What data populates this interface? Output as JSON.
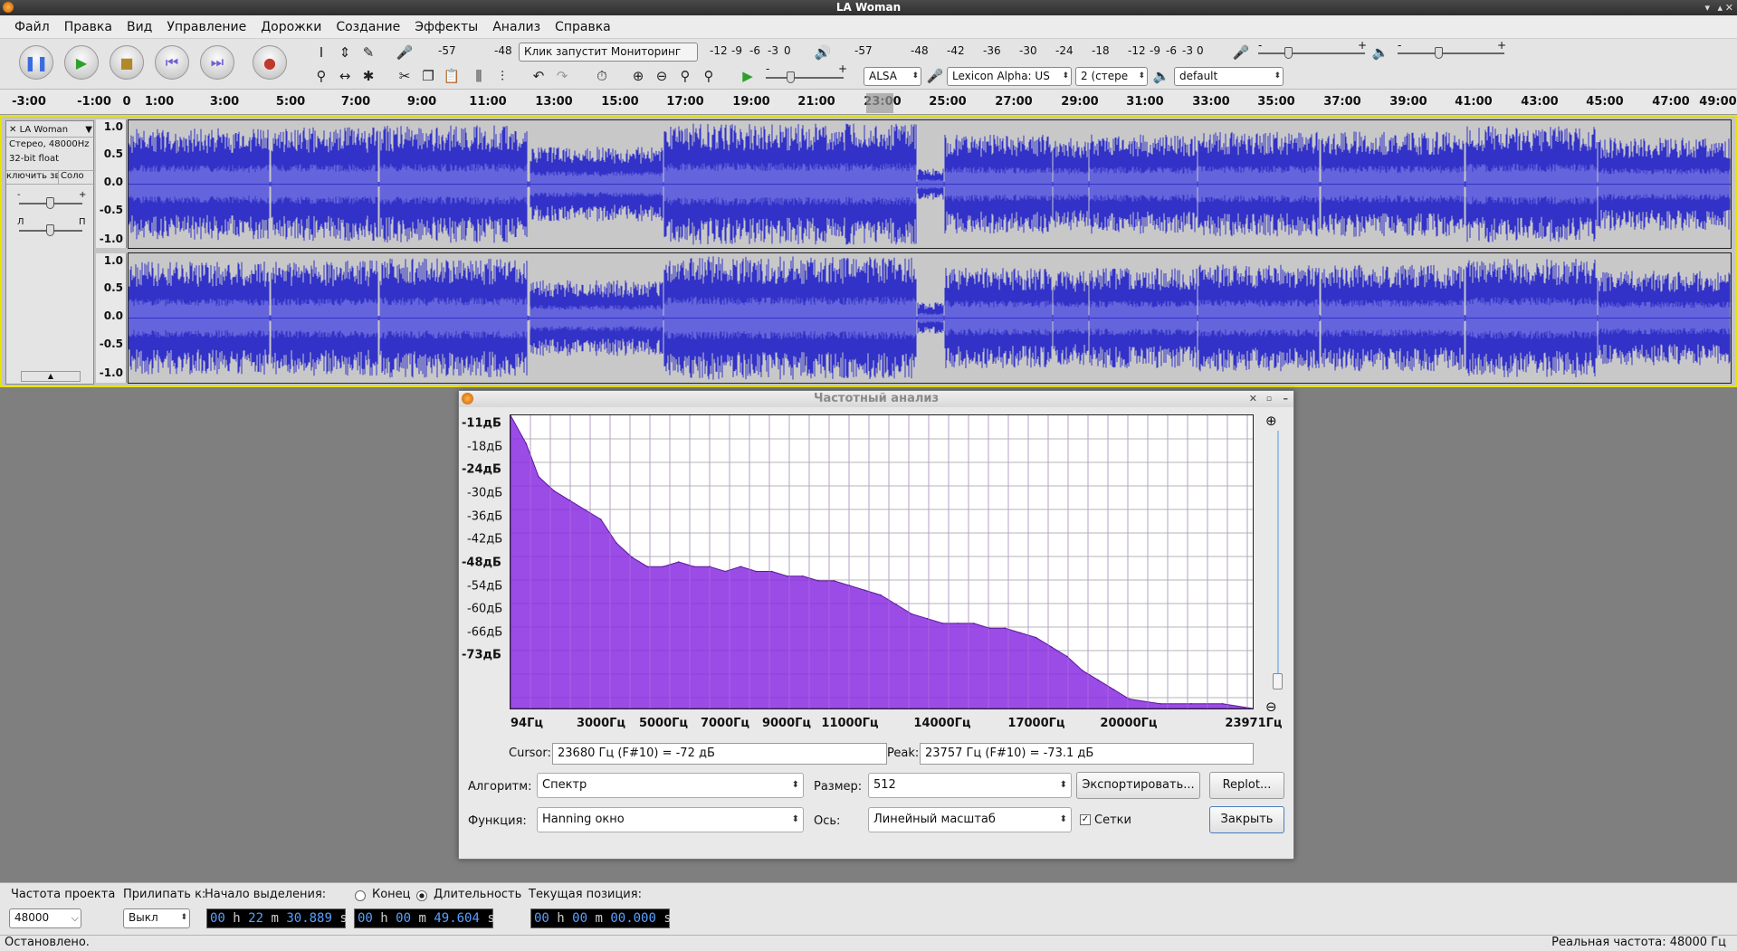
{
  "window": {
    "title": "LA Woman"
  },
  "menu": [
    "Файл",
    "Правка",
    "Вид",
    "Управление",
    "Дорожки",
    "Создание",
    "Эффекты",
    "Анализ",
    "Справка"
  ],
  "toolbar": {
    "rec_meter_ticks": [
      "-57",
      "-48",
      "-12",
      "-9",
      "-6",
      "-3",
      "0"
    ],
    "monitor_text": "Клик запустит Мониторинг",
    "play_meter_ticks": [
      "-57",
      "-48",
      "-42",
      "-36",
      "-30",
      "-24",
      "-18",
      "-12",
      "-9",
      "-6",
      "-3",
      "0"
    ],
    "host": "ALSA",
    "rec_device": "Lexicon Alpha: US",
    "channels": "2 (стере",
    "play_device": "default",
    "slider_minus": "-",
    "slider_plus": "+"
  },
  "ruler": {
    "labels": [
      "-3:00",
      "-1:00",
      "0",
      "1:00",
      "3:00",
      "5:00",
      "7:00",
      "9:00",
      "11:00",
      "13:00",
      "15:00",
      "17:00",
      "19:00",
      "21:00",
      "23:00",
      "25:00",
      "27:00",
      "29:00",
      "31:00",
      "33:00",
      "35:00",
      "37:00",
      "39:00",
      "41:00",
      "43:00",
      "45:00",
      "47:00",
      "49:00"
    ]
  },
  "track": {
    "name": "LA Woman",
    "info1": "Стерео, 48000Hz",
    "info2": "32-bit float",
    "mute": "ключить звук",
    "solo": "Соло",
    "gain_minus": "-",
    "gain_plus": "+",
    "pan_left": "Л",
    "pan_right": "П",
    "scale": [
      "1.0",
      "0.5",
      "0.0",
      "-0.5",
      "-1.0"
    ]
  },
  "dialog": {
    "title": "Частотный анализ",
    "y_labels": [
      "-11дБ",
      "-18дБ",
      "-24дБ",
      "-30дБ",
      "-36дБ",
      "-42дБ",
      "-48дБ",
      "-54дБ",
      "-60дБ",
      "-66дБ",
      "-73дБ"
    ],
    "x_labels": [
      "94Гц",
      "3000Гц",
      "5000Гц",
      "7000Гц",
      "9000Гц",
      "11000Гц",
      "14000Гц",
      "17000Гц",
      "20000Гц",
      "23971Гц"
    ],
    "cursor_label": "Cursor:",
    "cursor_value": "23680 Гц (F#10) = -72 дБ",
    "peak_label": "Peak:",
    "peak_value": "23757 Гц (F#10) = -73.1 дБ",
    "algorithm_label": "Алгоритм:",
    "algorithm_value": "Спектр",
    "size_label": "Размер:",
    "size_value": "512",
    "export_button": "Экспортировать...",
    "replot_button": "Replot...",
    "function_label": "Функция:",
    "function_value": "Hanning окно",
    "axis_label": "Ось:",
    "axis_value": "Линейный масштаб",
    "grids_label": "Сетки",
    "grids_checked": true,
    "close_button": "Закрыть"
  },
  "chart_data": {
    "type": "area",
    "title": "",
    "xlabel": "",
    "ylabel": "",
    "xlim": [
      94,
      23971
    ],
    "ylim": [
      -73,
      -11
    ],
    "grid": true,
    "color": "#8a2be2",
    "x": [
      94,
      600,
      1000,
      1500,
      2000,
      2500,
      3000,
      3500,
      4000,
      4500,
      5000,
      5500,
      6000,
      6500,
      7000,
      7500,
      8000,
      8500,
      9000,
      9500,
      10000,
      10500,
      11000,
      11500,
      12000,
      12500,
      13000,
      13500,
      14000,
      14500,
      15000,
      15500,
      16000,
      16500,
      17000,
      17500,
      18000,
      18500,
      19000,
      19500,
      20000,
      21000,
      22000,
      23000,
      23971
    ],
    "y": [
      -11,
      -17,
      -24,
      -27,
      -29,
      -31,
      -33,
      -38,
      -41,
      -43,
      -43,
      -42,
      -43,
      -43,
      -44,
      -43,
      -44,
      -44,
      -45,
      -45,
      -46,
      -46,
      -47,
      -48,
      -49,
      -51,
      -53,
      -54,
      -55,
      -55,
      -55,
      -56,
      -56,
      -57,
      -58,
      -60,
      -62,
      -65,
      -67,
      -69,
      -71,
      -72,
      -72,
      -72,
      -73
    ]
  },
  "bottom": {
    "project_rate_label": "Частота проекта",
    "project_rate": "48000",
    "snap_label": "Прилипать к:",
    "snap_value": "Выкл",
    "sel_start_label": "Начало выделения:",
    "end_label": "Конец",
    "length_label": "Длительность",
    "cur_pos_label": "Текущая позиция:",
    "sel_start": [
      "00",
      "h",
      "22",
      "m",
      "30.889",
      "s"
    ],
    "sel_length": [
      "00",
      "h",
      "00",
      "m",
      "49.604",
      "s"
    ],
    "cur_pos": [
      "00",
      "h",
      "00",
      "m",
      "00.000",
      "s"
    ]
  },
  "status": {
    "left": "Остановлено.",
    "right": "Реальная частота: 48000 Гц"
  }
}
